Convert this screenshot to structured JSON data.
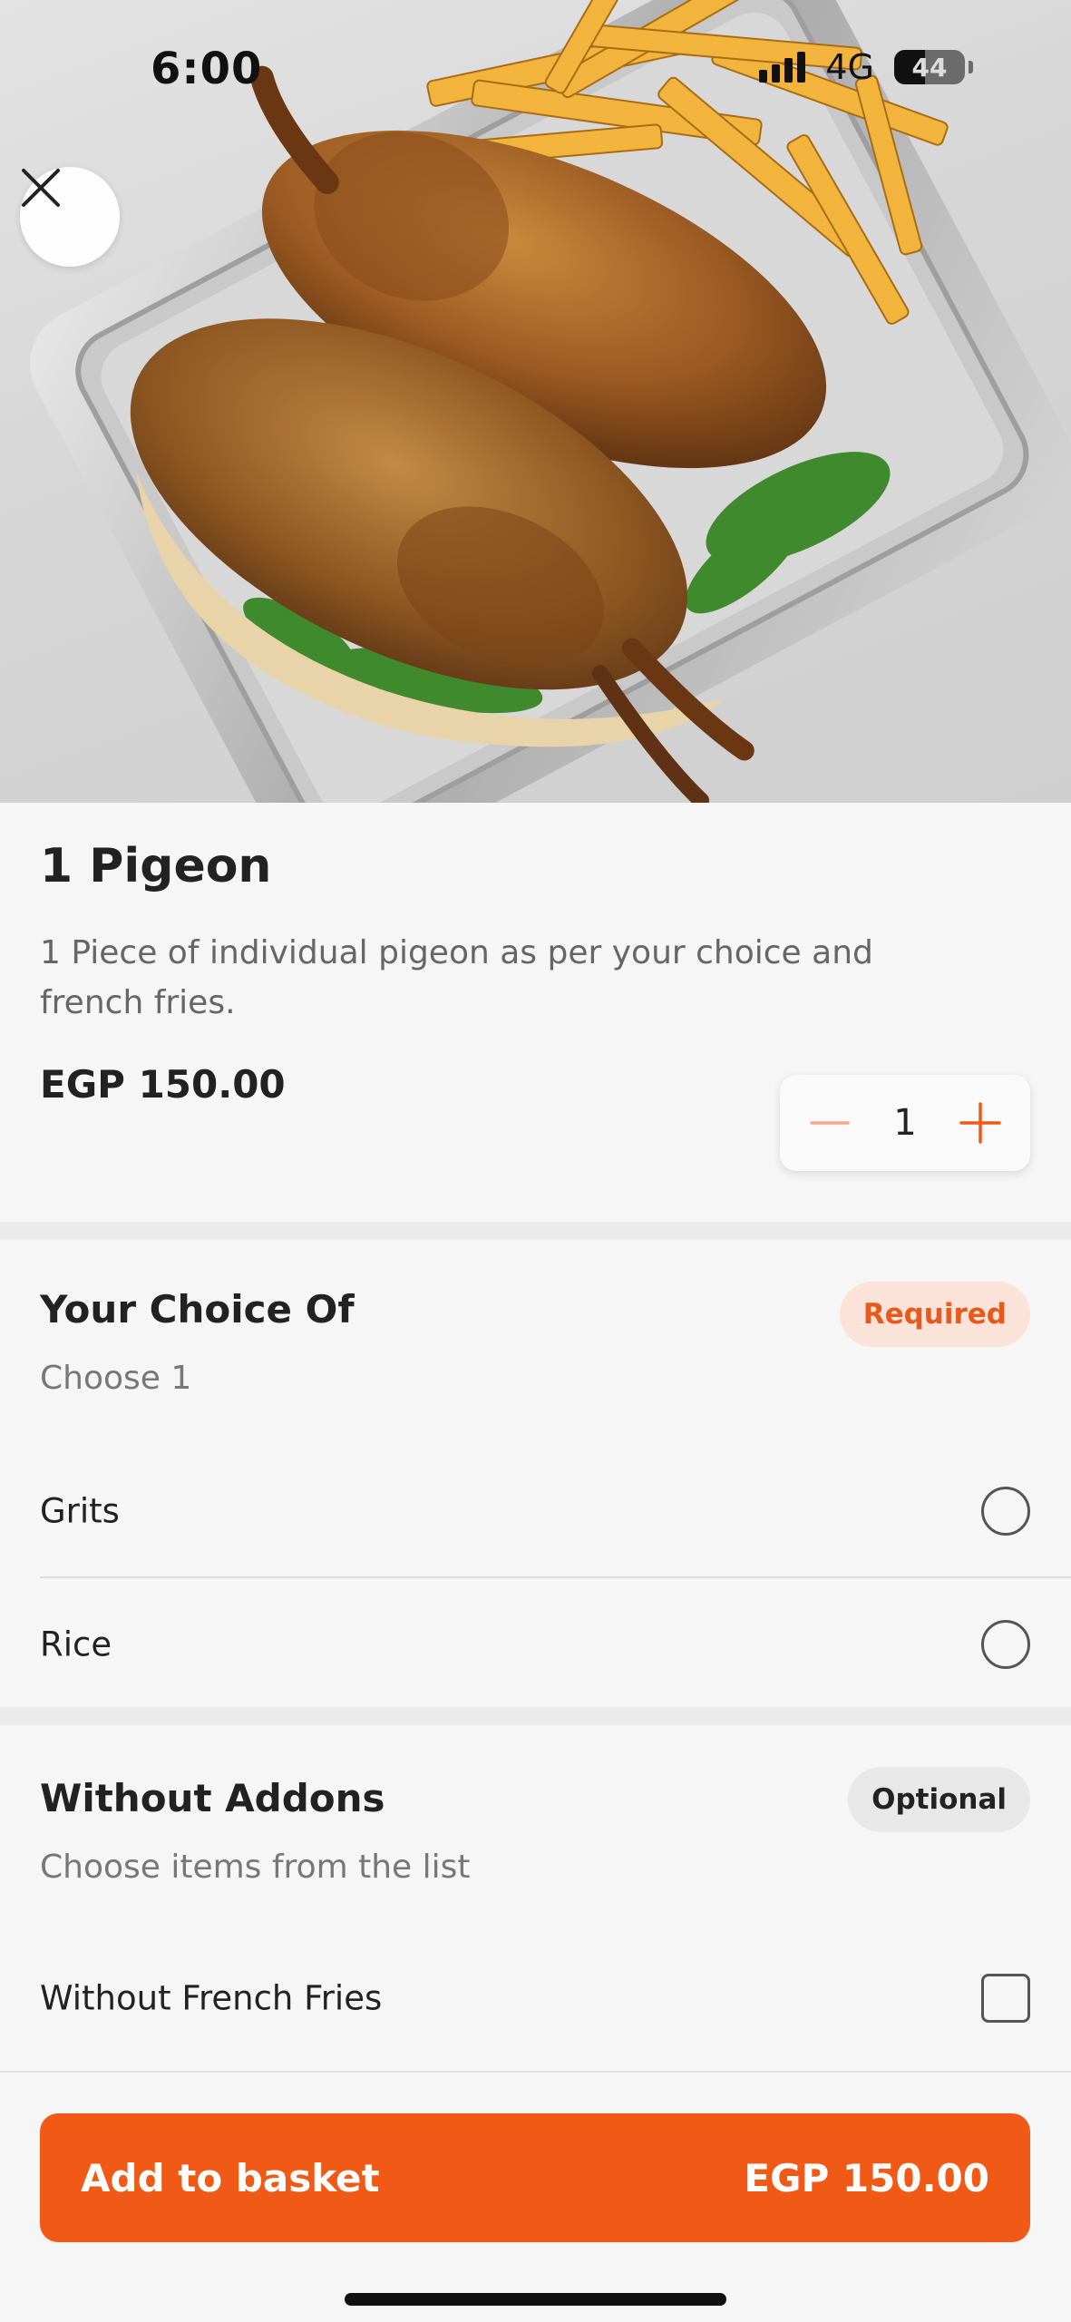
{
  "status_bar": {
    "time": "6:00",
    "network": "4G",
    "battery": "44",
    "battery_level": 0.44
  },
  "hero": {
    "image_subject": "roasted pigeons with french fries in foil tray",
    "close_icon": "close-icon"
  },
  "product": {
    "title": "1 Pigeon",
    "description": "1 Piece of individual pigeon as per your choice and french fries.",
    "price": "EGP 150.00",
    "quantity": "1"
  },
  "groups": [
    {
      "title": "Your Choice Of",
      "subtitle": "Choose 1",
      "badge": "Required",
      "options": [
        {
          "label": "Grits",
          "selected": false
        },
        {
          "label": "Rice",
          "selected": false
        }
      ]
    },
    {
      "title": "Without Addons",
      "subtitle": "Choose items from the list",
      "badge": "Optional",
      "options": [
        {
          "label": "Without French Fries",
          "checked": false
        }
      ]
    }
  ],
  "cta": {
    "label": "Add to basket",
    "price": "EGP 150.00"
  },
  "colors": {
    "accent": "#f05a16",
    "badge_required_bg": "#fbe3da",
    "badge_optional_bg": "#e8e8e8",
    "background": "#f6f6f6"
  }
}
